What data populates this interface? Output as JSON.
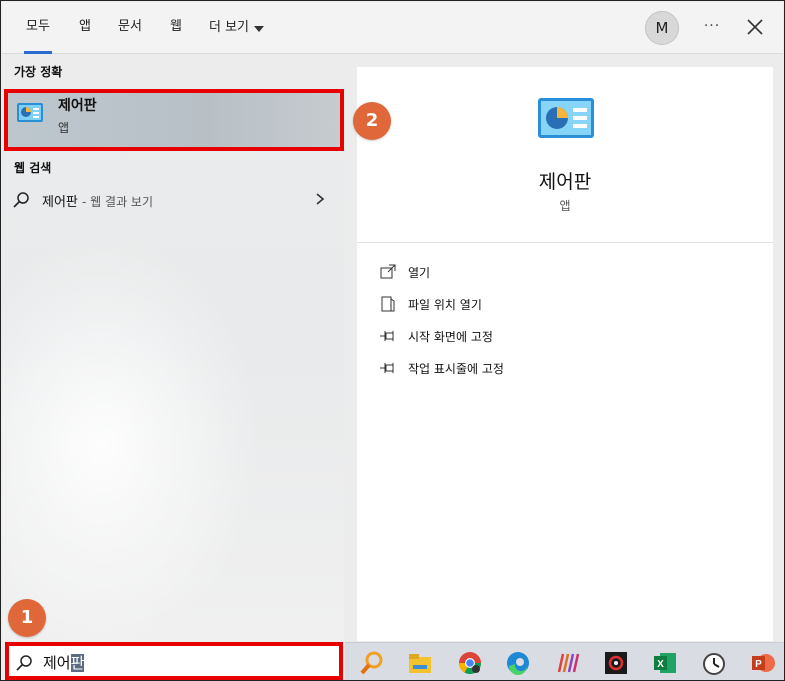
{
  "tabs": [
    {
      "label": "모두",
      "active": true
    },
    {
      "label": "앱"
    },
    {
      "label": "문서"
    },
    {
      "label": "웹"
    },
    {
      "label": "더 보기"
    }
  ],
  "account": {
    "initial": "M"
  },
  "top_actions": {
    "more": "···"
  },
  "left": {
    "best_match_heading": "가장 정확",
    "best_match": {
      "title": "제어판",
      "subtitle": "앱"
    },
    "web_heading": "웹 검색",
    "web_result": {
      "query": "제어판",
      "suffix": "- 웹 결과 보기"
    }
  },
  "right": {
    "title": "제어판",
    "subtitle": "앱",
    "actions": [
      {
        "label": "열기",
        "icon": "open-icon"
      },
      {
        "label": "파일 위치 열기",
        "icon": "file-location-icon"
      },
      {
        "label": "시작 화면에 고정",
        "icon": "pin-icon"
      },
      {
        "label": "작업 표시줄에 고정",
        "icon": "pin-icon"
      }
    ]
  },
  "badges": [
    "1",
    "2"
  ],
  "search": {
    "typed": "제어",
    "selected": "판"
  },
  "taskbar_icons": [
    "search-app-icon",
    "file-explorer-icon",
    "chrome-icon",
    "edge-icon",
    "app-stripes-icon",
    "media-app-icon",
    "excel-icon",
    "clock-app-icon",
    "powerpoint-icon"
  ],
  "colors": {
    "accent": "#2b6cd2",
    "highlight": "#e60000",
    "badge": "#e0673a"
  }
}
